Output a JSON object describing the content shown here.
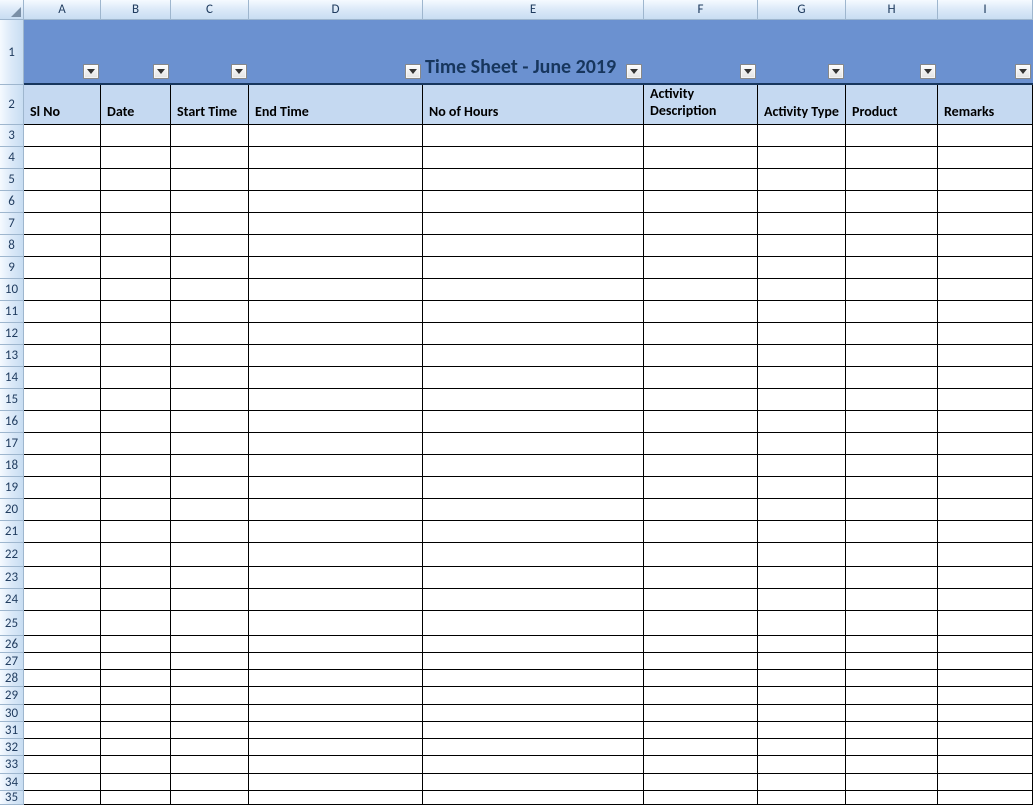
{
  "columns": [
    "A",
    "B",
    "C",
    "D",
    "E",
    "F",
    "G",
    "H",
    "I"
  ],
  "title": "Time Sheet - June 2019",
  "headers": {
    "A": "Sl No",
    "B": "Date",
    "C": "Start Time",
    "D": "End Time",
    "E": "No of Hours",
    "F": "Activity Description",
    "G": "Activity Type",
    "H": "Product",
    "I": "Remarks"
  },
  "row_numbers": [
    1,
    2,
    3,
    4,
    5,
    6,
    7,
    8,
    9,
    10,
    11,
    12,
    13,
    14,
    15,
    16,
    17,
    18,
    19,
    20,
    21,
    22,
    23,
    24,
    25,
    26,
    27,
    28,
    29,
    30,
    31,
    32,
    33,
    34,
    35
  ],
  "data_row_heights": [
    22,
    22,
    22,
    22,
    22,
    22,
    22,
    22,
    22,
    22,
    22,
    22,
    22,
    22,
    22,
    22,
    22,
    22,
    22,
    24,
    22,
    22,
    25,
    17,
    17,
    17,
    18,
    17,
    17,
    17,
    18,
    17,
    14
  ]
}
